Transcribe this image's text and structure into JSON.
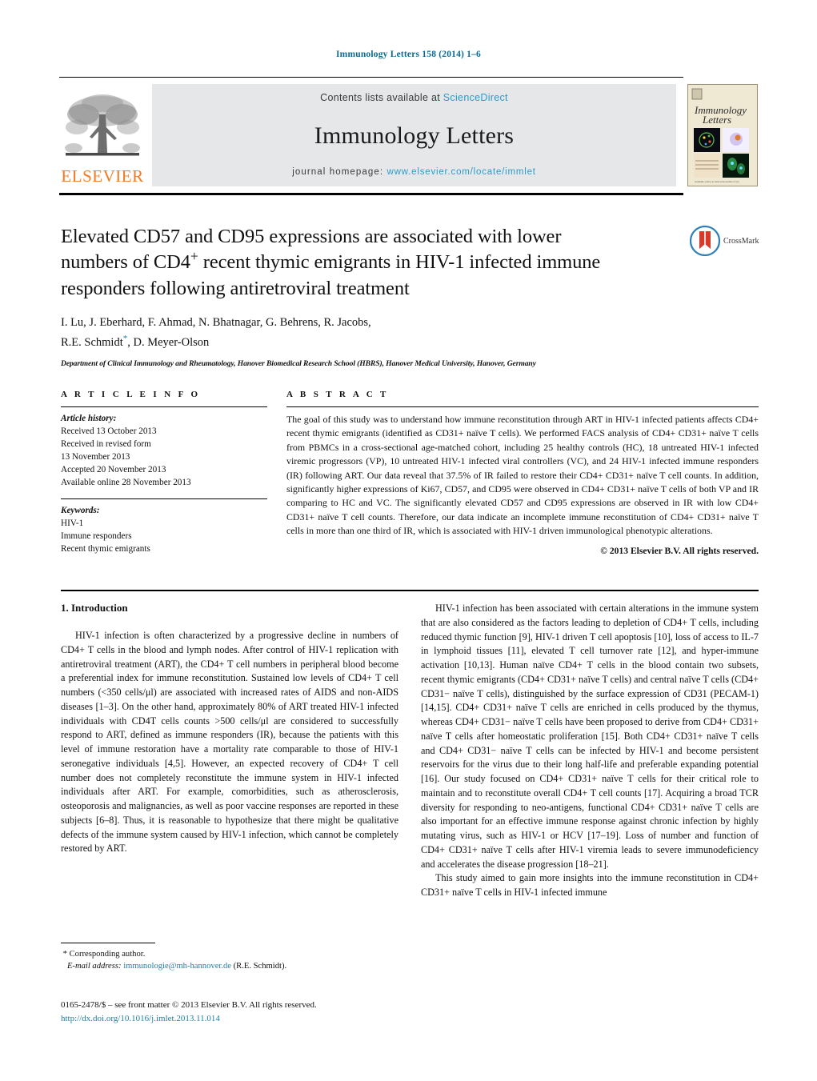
{
  "running_head": "Immunology Letters 158 (2014) 1–6",
  "masthead": {
    "contents_prefix": "Contents lists available at ",
    "sciencedirect": "ScienceDirect",
    "journal_name": "Immunology Letters",
    "homepage_prefix": "journal homepage:",
    "homepage_url": "www.elsevier.com/locate/immlet",
    "publisher": "ELSEVIER",
    "cover_title": "Immunology Letters",
    "link_color": "#2d9bc9",
    "brand_color": "#F47920"
  },
  "article": {
    "title": "Elevated CD57 and CD95 expressions are associated with lower numbers of CD4+ recent thymic emigrants in HIV-1 infected immune responders following antiretroviral treatment",
    "title_line1": "Elevated CD57 and CD95 expressions are associated with lower",
    "title_line2_a": "numbers of CD4",
    "title_line2_sup": "+",
    "title_line2_b": " recent thymic emigrants in HIV-1 infected immune",
    "title_line3": "responders following antiretroviral treatment",
    "authors_line1": "I. Lu, J. Eberhard, F. Ahmad, N. Bhatnagar, G. Behrens, R. Jacobs,",
    "authors_line2_a": "R.E. Schmidt",
    "authors_corresponding_marker": "*",
    "authors_line2_b": ", D. Meyer-Olson",
    "affiliation": "Department of Clinical Immunology and Rheumatology, Hanover Biomedical Research School (HBRS), Hanover Medical University, Hanover, Germany",
    "crossmark_label": "CrossMark"
  },
  "article_info": {
    "heading": "A R T I C L E    I N F O",
    "history_label": "Article history:",
    "history": [
      "Received 13 October 2013",
      "Received in revised form",
      "13 November 2013",
      "Accepted 20 November 2013",
      "Available online 28 November 2013"
    ],
    "keywords_label": "Keywords:",
    "keywords": [
      "HIV-1",
      "Immune responders",
      "Recent thymic emigrants"
    ]
  },
  "abstract": {
    "heading": "A B S T R A C T",
    "text": "The goal of this study was to understand how immune reconstitution through ART in HIV-1 infected patients affects CD4+ recent thymic emigrants (identified as CD31+ naïve T cells). We performed FACS analysis of CD4+ CD31+ naïve T cells from PBMCs in a cross-sectional age-matched cohort, including 25 healthy controls (HC), 18 untreated HIV-1 infected viremic progressors (VP), 10 untreated HIV-1 infected viral controllers (VC), and 24 HIV-1 infected immune responders (IR) following ART. Our data reveal that 37.5% of IR failed to restore their CD4+ CD31+ naïve T cell counts. In addition, significantly higher expressions of Ki67, CD57, and CD95 were observed in CD4+ CD31+ naïve T cells of both VP and IR comparing to HC and VC. The significantly elevated CD57 and CD95 expressions are observed in IR with low CD4+ CD31+ naïve T cell counts. Therefore, our data indicate an incomplete immune reconstitution of CD4+ CD31+ naïve T cells in more than one third of IR, which is associated with HIV-1 driven immunological phenotypic alterations.",
    "copyright": "© 2013 Elsevier B.V. All rights reserved."
  },
  "body": {
    "section_number_title": "1.  Introduction",
    "left_paragraph_1": "HIV-1 infection is often characterized by a progressive decline in numbers of CD4+ T cells in the blood and lymph nodes. After control of HIV-1 replication with antiretroviral treatment (ART), the CD4+ T cell numbers in peripheral blood become a preferential index for immune reconstitution. Sustained low levels of CD4+ T cell numbers (<350 cells/μl) are associated with increased rates of AIDS and non-AIDS diseases [1–3]. On the other hand, approximately 80% of ART treated HIV-1 infected individuals with CD4T cells counts >500 cells/μl are considered to successfully respond to ART, defined as immune responders (IR), because the patients with this level of immune restoration have a mortality rate comparable to those of HIV-1 seronegative individuals [4,5]. However, an expected recovery of CD4+ T cell number does not completely reconstitute the immune system in HIV-1 infected individuals after ART. For example, comorbidities, such as atherosclerosis, osteoporosis and malignancies, as well as poor vaccine responses are reported in these subjects [6–8]. Thus, it is reasonable to hypothesize that there might be qualitative defects of the immune system caused by HIV-1 infection, which cannot be completely restored by ART.",
    "right_paragraph_1": "HIV-1 infection has been associated with certain alterations in the immune system that are also considered as the factors leading to depletion of CD4+ T cells, including reduced thymic function [9], HIV-1 driven T cell apoptosis [10], loss of access to IL-7 in lymphoid tissues [11], elevated T cell turnover rate [12], and hyper-immune activation [10,13]. Human naïve CD4+ T cells in the blood contain two subsets, recent thymic emigrants (CD4+ CD31+ naïve T cells) and central naïve T cells (CD4+ CD31− naïve T cells), distinguished by the surface expression of CD31 (PECAM-1) [14,15]. CD4+ CD31+ naïve T cells are enriched in cells produced by the thymus, whereas CD4+ CD31− naïve T cells have been proposed to derive from CD4+ CD31+ naïve T cells after homeostatic proliferation [15]. Both CD4+ CD31+ naïve T cells and CD4+ CD31− naïve T cells can be infected by HIV-1 and become persistent reservoirs for the virus due to their long half-life and preferable expanding potential [16]. Our study focused on CD4+ CD31+ naïve T cells for their critical role to maintain and to reconstitute overall CD4+ T cell counts [17]. Acquiring a broad TCR diversity for responding to neo-antigens, functional CD4+ CD31+ naïve T cells are also important for an effective immune response against chronic infection by highly mutating virus, such as HIV-1 or HCV [17–19]. Loss of number and function of CD4+ CD31+ naïve T cells after HIV-1 viremia leads to severe immunodeficiency and accelerates the disease progression [18–21].",
    "right_paragraph_2": "This study aimed to gain more insights into the immune reconstitution in CD4+ CD31+ naïve T cells in HIV-1 infected immune"
  },
  "footnote": {
    "corresponding_marker": "*",
    "corresponding_text": "Corresponding author.",
    "email_label": "E-mail address:",
    "email": "immunologie@mh-hannover.de",
    "email_owner": "(R.E. Schmidt).",
    "issn_line": "0165-2478/$ – see front matter © 2013 Elsevier B.V. All rights reserved.",
    "doi_url": "http://dx.doi.org/10.1016/j.imlet.2013.11.014"
  }
}
